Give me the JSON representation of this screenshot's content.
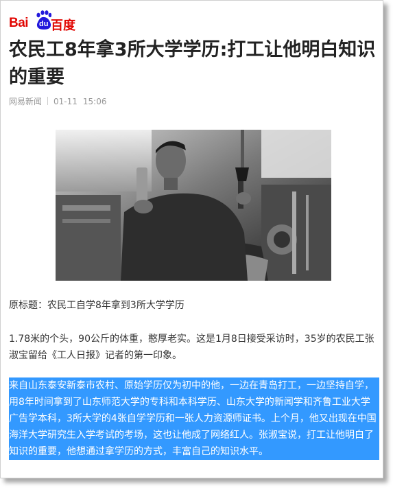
{
  "logo": {
    "text_latin": "Bai",
    "text_du": "du",
    "text_cn": "百度"
  },
  "article": {
    "title": "农民工8年拿3所大学学历:打工让他明白知识的重要",
    "source": "网易新闻",
    "date": "01-11",
    "time": "15:06",
    "image_alt": "photo-of-worker-in-factory",
    "paragraphs": [
      "原标题：农民工自学8年拿到3所大学学历",
      "1.78米的个头，90公斤的体重，憨厚老实。这是1月8日接受采访时，35岁的农民工张淑宝留给《工人日报》记者的第一印象。",
      "来自山东泰安新泰市农村、原始学历仅为初中的他，一边在青岛打工，一边坚持自学，用8年时间拿到了山东师范大学的专科和本科学历、山东大学的新闻学和齐鲁工业大学广告学本科，3所大学的4张自学学历和一张人力资源师证书。上个月，他又出现在中国海洋大学研究生入学考试的考场，这也让他成了网络红人。张淑宝说，打工让他明白了知识的重要，他想通过拿学历的方式，丰富自己的知识水平。"
    ]
  },
  "colors": {
    "brand_red": "#e10602",
    "selection": "#3399ff",
    "meta_gray": "#999999"
  }
}
